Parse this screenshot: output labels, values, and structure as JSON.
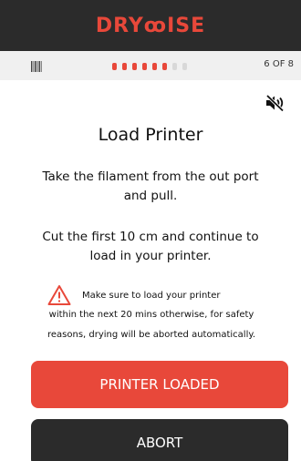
{
  "header": {
    "logo_text": "DRYꝏISE",
    "brand_color": "#e8483a",
    "background": "#2b2b2b"
  },
  "status": {
    "icon": "barcode-icon",
    "progress": {
      "current": 6,
      "total": 8
    },
    "step_label": "6 OF 8"
  },
  "sound": {
    "icon": "speaker-muted-icon"
  },
  "main": {
    "title": "Load Printer",
    "instruction_1": "Take the filament from the out port and pull.",
    "instruction_2": "Cut the first 10 cm and continue to load in your printer.",
    "warning": {
      "icon": "warning-triangle-icon",
      "line_1": "Make sure to load your printer",
      "line_2": "within the next 20 mins otherwise, for safety",
      "line_3": "reasons, drying will be aborted automatically."
    }
  },
  "actions": {
    "primary_label": "PRINTER LOADED",
    "secondary_label": "ABORT"
  }
}
